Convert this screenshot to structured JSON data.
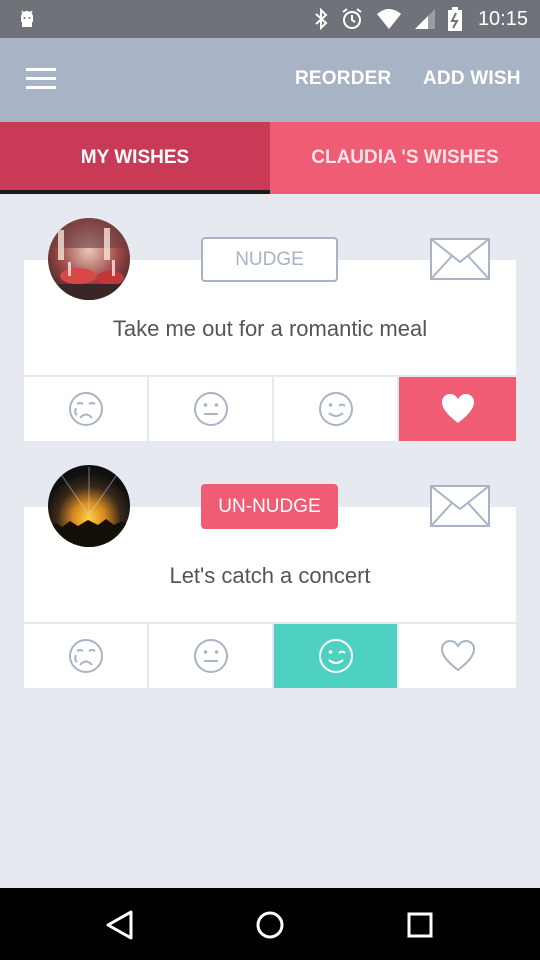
{
  "status_bar": {
    "time": "10:15"
  },
  "app_bar": {
    "reorder_label": "REORDER",
    "add_wish_label": "ADD WISH"
  },
  "tabs": [
    {
      "label": "MY WISHES",
      "active": true
    },
    {
      "label": "CLAUDIA 'S WISHES",
      "active": false
    }
  ],
  "wishes": [
    {
      "title": "Take me out for a romantic meal",
      "nudge_label": "NUDGE",
      "nudged": false,
      "selected_reaction": "heart"
    },
    {
      "title": "Let's catch a concert",
      "nudge_label": "UN-NUDGE",
      "nudged": true,
      "selected_reaction": "wink"
    }
  ],
  "colors": {
    "accent_pink": "#ef5c74",
    "dark_pink": "#c83a55",
    "teal": "#4fd1c1",
    "appbar": "#a8b3c5"
  }
}
